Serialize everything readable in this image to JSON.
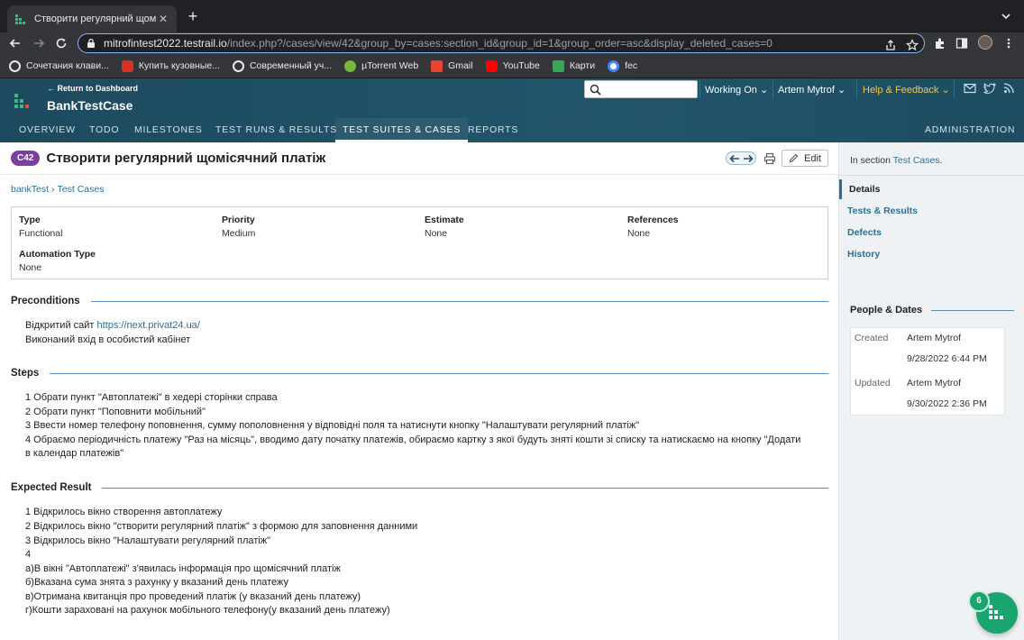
{
  "browser": {
    "tab_title": "Створити регулярний щомісячний платіж - BankTestCase - TestRail",
    "url_host": "mitrofintest2022.testrail.io",
    "url_path": "/index.php?/cases/view/42&group_by=cases:section_id&group_id=1&group_order=asc&display_deleted_cases=0",
    "bookmarks": [
      {
        "label": "Сочетания клави...",
        "icon": "globe-icon",
        "color": "#e8eaed"
      },
      {
        "label": "Купить кузовные...",
        "icon": "car-icon",
        "color": "#d93025"
      },
      {
        "label": "Современный уч...",
        "icon": "globe-icon",
        "color": "#e8eaed"
      },
      {
        "label": "µTorrent Web",
        "icon": "utorrent-icon",
        "color": "#76b83f"
      },
      {
        "label": "Gmail",
        "icon": "gmail-icon",
        "color": "#ea4335"
      },
      {
        "label": "YouTube",
        "icon": "youtube-icon",
        "color": "#ff0000"
      },
      {
        "label": "Карти",
        "icon": "maps-icon",
        "color": "#34a853"
      },
      {
        "label": "fec",
        "icon": "google-icon",
        "color": "#4285f4"
      }
    ]
  },
  "header": {
    "return_link": "← Return to Dashboard",
    "project_name": "BankTestCase",
    "working_on": "Working On",
    "user": "Artem Mytrof",
    "help": "Help & Feedback",
    "nav": [
      "OVERVIEW",
      "TODO",
      "MILESTONES",
      "TEST RUNS & RESULTS",
      "TEST SUITES & CASES",
      "REPORTS",
      "ADMINISTRATION"
    ],
    "active_nav": "TEST SUITES & CASES"
  },
  "case": {
    "id_badge": "C42",
    "title": "Створити регулярний щомісячний платіж",
    "edit_label": "Edit",
    "breadcrumb_project": "bankTest",
    "breadcrumb_section": "Test Cases",
    "fields": {
      "type_label": "Type",
      "type_value": "Functional",
      "priority_label": "Priority",
      "priority_value": "Medium",
      "estimate_label": "Estimate",
      "estimate_value": "None",
      "references_label": "References",
      "references_value": "None",
      "automation_label": "Automation Type",
      "automation_value": "None"
    },
    "preconditions_title": "Preconditions",
    "preconditions": {
      "line1_prefix": "Відкритий сайт ",
      "line1_link": "https://next.privat24.ua/",
      "line2": "Виконаний вхід в особистий кабінет"
    },
    "steps_title": "Steps",
    "steps": [
      "1 Обрати пункт \"Автоплатежі\" в хедері сторінки справа",
      "2 Обрати пункт \"Поповнити мобільний\"",
      "3 Ввести номер телефону поповнення, сумму пополовнення у відповідні поля та натиснути кнопку \"Налаштувати регулярний платіж\"",
      "4 Обраємо періодичність платежу \"Раз на місяць\", вводимо дату початку платежів, обираємо картку з якої будуть зняті кошти зі списку та натискаємо на кнопку \"Додати",
      "в календар платежів\""
    ],
    "expected_title": "Expected Result",
    "expected": [
      "1 Відкрилось вікно створення автоплатежу",
      "2 Відкрилось вікно \"створити регулярний платіж\" з формою для заповнення данними",
      "3 Відкрилось вікно \"Налаштувати регулярний платіж\"",
      "4",
      "а)В вікні \"Автоплатежі\" з'явилась інформація про щомісячний платіж",
      "б)Вказана сума знята з рахунку у вказаний день платежу",
      "в)Отримана квитанція про проведений платіж (у вказаний день платежу)",
      "г)Кошти зараховані на рахунок мобільного телефону(у вказаний день платежу)"
    ]
  },
  "sidebar": {
    "in_section_prefix": "In section ",
    "in_section_link": "Test Cases",
    "in_section_suffix": ".",
    "tabs": [
      "Details",
      "Tests & Results",
      "Defects",
      "History"
    ],
    "people_title": "People & Dates",
    "created_label": "Created",
    "created_by": "Artem Mytrof",
    "created_date": "9/28/2022 6:44 PM",
    "updated_label": "Updated",
    "updated_by": "Artem Mytrof",
    "updated_date": "9/30/2022 2:36 PM"
  },
  "help_badge": "6",
  "colors": {
    "header_bg": "#1f4e63",
    "badge": "#7b3fa0",
    "link": "#2f6f94",
    "help_fab": "#1aa56f",
    "help_text": "#f2c94c"
  }
}
